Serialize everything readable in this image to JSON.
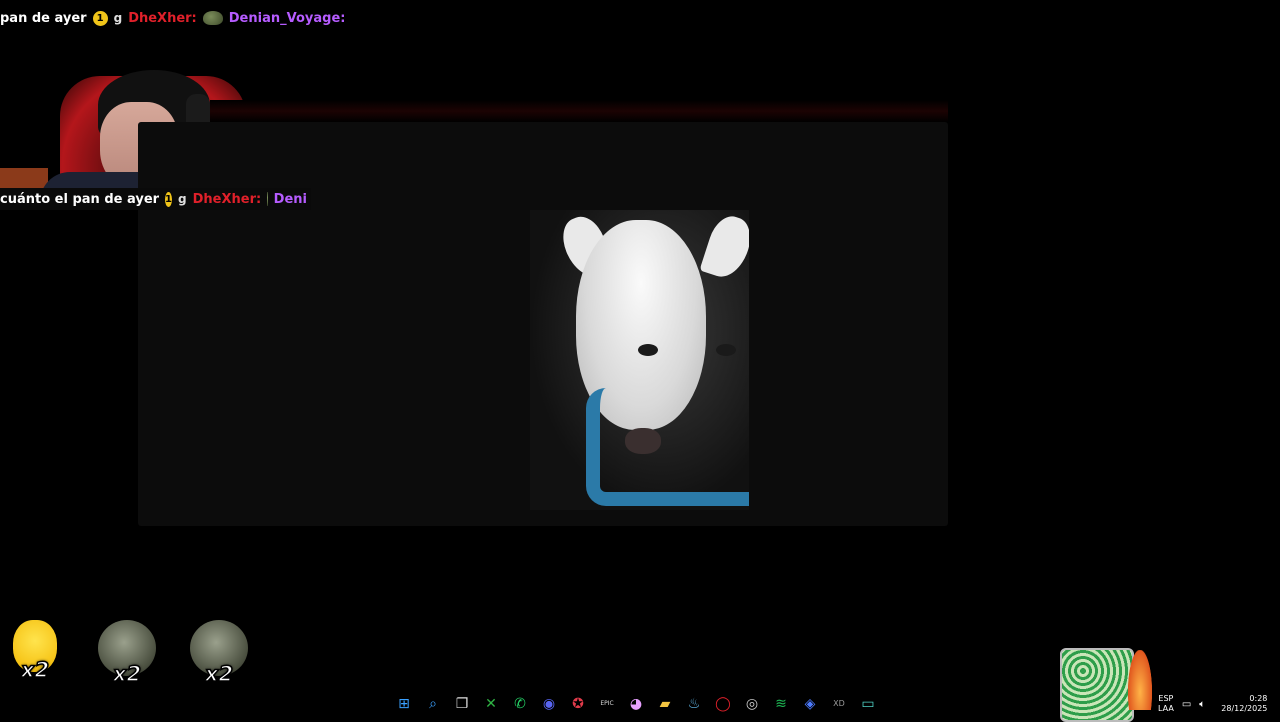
{
  "chat": {
    "top_line": {
      "text": "pan de ayer",
      "badge": "1",
      "badge2": "g",
      "user1": "DheXher:",
      "user2": "Denian_Voyage:"
    },
    "mid_line": {
      "text": "cuánto el pan de ayer",
      "badge": "1",
      "badge2": "g",
      "user1": "DheXher:",
      "user2": "Deni"
    }
  },
  "rewards": [
    {
      "icon": "yellow-emote",
      "count": "x2"
    },
    {
      "icon": "rock-emote",
      "count": "x2"
    },
    {
      "icon": "rock-emote",
      "count": "x2"
    }
  ],
  "taskbar": {
    "icons": [
      {
        "name": "windows-start-icon",
        "glyph": "⊞",
        "color": "#3aa0ff"
      },
      {
        "name": "search-icon",
        "glyph": "⌕",
        "color": "#3aa0ff"
      },
      {
        "name": "task-view-icon",
        "glyph": "❐",
        "color": "#dddddd"
      },
      {
        "name": "xbox-icon",
        "glyph": "✕",
        "color": "#2fb344"
      },
      {
        "name": "whatsapp-icon",
        "glyph": "✆",
        "color": "#25d366"
      },
      {
        "name": "discord-icon",
        "glyph": "◉",
        "color": "#5865f2"
      },
      {
        "name": "streaming-app-icon",
        "glyph": "✪",
        "color": "#e23b4b"
      },
      {
        "name": "epic-games-icon",
        "glyph": "EPIC",
        "color": "#dddddd"
      },
      {
        "name": "browser-icon",
        "glyph": "◕",
        "color": "#e8a0ff"
      },
      {
        "name": "file-explorer-icon",
        "glyph": "▰",
        "color": "#f4c542"
      },
      {
        "name": "steam-icon",
        "glyph": "♨",
        "color": "#66c0f4"
      },
      {
        "name": "opera-icon",
        "glyph": "◯",
        "color": "#e0202a"
      },
      {
        "name": "obs-icon",
        "glyph": "◎",
        "color": "#cccccc"
      },
      {
        "name": "spotify-icon",
        "glyph": "≋",
        "color": "#1db954"
      },
      {
        "name": "app-diamond-icon",
        "glyph": "◈",
        "color": "#4d7bff"
      },
      {
        "name": "xdpen-icon",
        "glyph": "XD",
        "color": "#9a9a9a"
      },
      {
        "name": "terminal-icon",
        "glyph": "▭",
        "color": "#4fd1c5"
      }
    ],
    "lang_top": "ESP",
    "lang_bottom": "LAA",
    "time": "0:28",
    "date": "28/12/2025"
  }
}
